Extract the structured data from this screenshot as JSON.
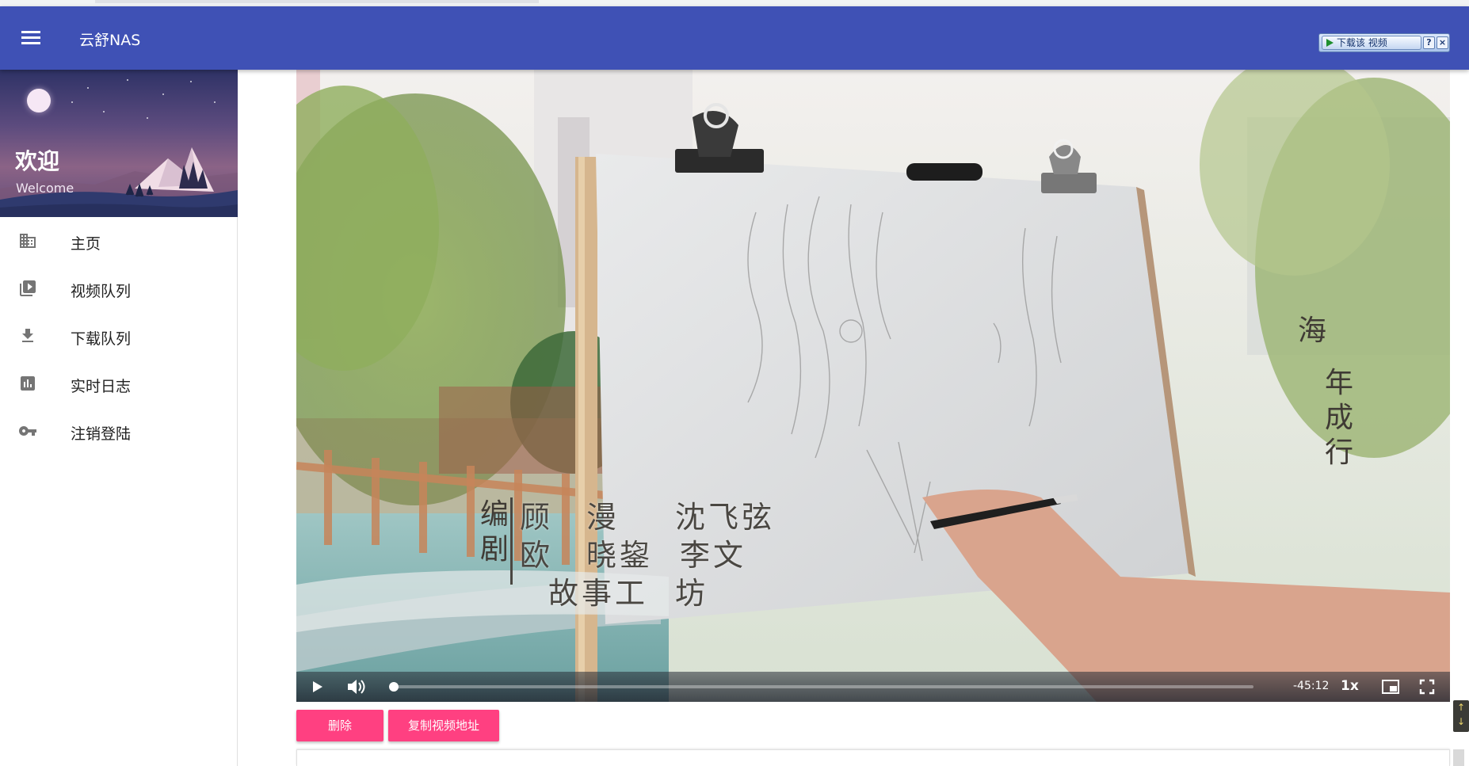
{
  "app": {
    "title": "云舒NAS"
  },
  "download_toolbar": {
    "label": "下载该 视频",
    "help": "?",
    "close": "×"
  },
  "sidebar": {
    "welcome_title": "欢迎",
    "welcome_subtitle": "Welcome",
    "items": [
      {
        "label": "主页",
        "icon": "building-icon"
      },
      {
        "label": "视频队列",
        "icon": "video-library-icon"
      },
      {
        "label": "下载队列",
        "icon": "download-icon"
      },
      {
        "label": "实时日志",
        "icon": "bar-chart-icon"
      },
      {
        "label": "注销登陆",
        "icon": "key-icon"
      }
    ]
  },
  "video": {
    "credits": {
      "vertical_label": "编\n剧",
      "line1": [
        "顾　漫",
        "沈飞弦"
      ],
      "line2": [
        "欧　晓鋆",
        "李文"
      ],
      "line3": [
        "故事工",
        "坊"
      ],
      "right_vertical_a": "海",
      "right_vertical_b": "年\n成\n行"
    },
    "controls": {
      "time_remaining": "-45:12",
      "speed": "1x",
      "progress_fraction": 0.003
    }
  },
  "actions": {
    "delete_label": "删除",
    "copy_label": "复制视频地址"
  },
  "colors": {
    "appbar": "#3f51b5",
    "accent": "#ff4081"
  }
}
